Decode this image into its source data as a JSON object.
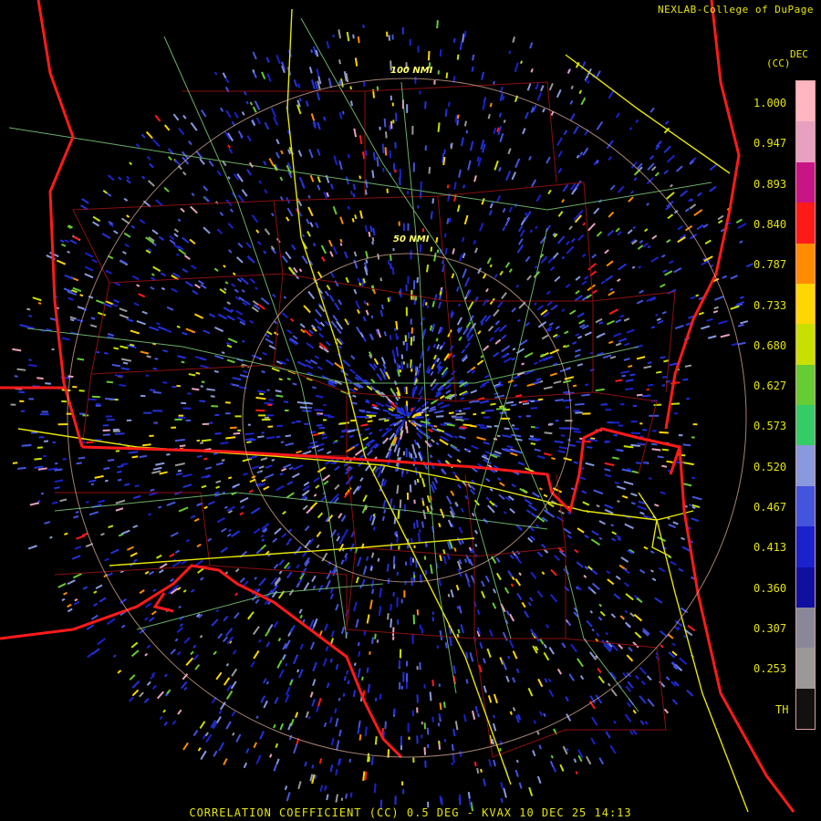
{
  "header": {
    "credit": "NEXLAB-College of DuPage"
  },
  "rings": {
    "outer_label": "100 NMI",
    "inner_label": "50 NMI"
  },
  "legend": {
    "unit_top": "DEC",
    "unit_sub": "(CC)",
    "ticks": [
      "1.000",
      "0.947",
      "0.893",
      "0.840",
      "0.787",
      "0.733",
      "0.680",
      "0.627",
      "0.573",
      "0.520",
      "0.467",
      "0.413",
      "0.360",
      "0.307",
      "0.253",
      "TH"
    ],
    "gradient": [
      "#ffb6c1",
      "#e8a0c0",
      "#c71585",
      "#ff1a1a",
      "#ff8c00",
      "#ffd700",
      "#c8e000",
      "#66cc33",
      "#33cc66",
      "#8899dd",
      "#4455dd",
      "#1a22cc",
      "#1010a0",
      "#888899",
      "#999999",
      "#111111"
    ]
  },
  "colors": {
    "background": "#000000",
    "state_boundary": "#ff1a1a",
    "county_boundary": "#8b1010",
    "highway": "#e6e600",
    "road": "#7ccd7c",
    "range_ring": "#e8b8a0",
    "text": "#e6e600"
  },
  "footer": {
    "caption": "CORRELATION COEFFICIENT (CC) 0.5 DEG - KVAX 10 DEC 25 14:13"
  }
}
